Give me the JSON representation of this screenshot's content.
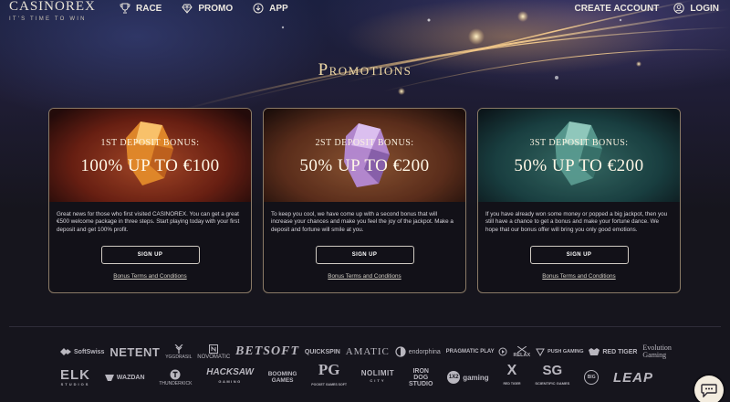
{
  "brand": {
    "name": "CASINOREX",
    "tagline": "IT'S TIME TO WIN"
  },
  "nav": {
    "left": [
      {
        "label": "RACE",
        "icon": "trophy-icon"
      },
      {
        "label": "PROMO",
        "icon": "diamond-icon"
      },
      {
        "label": "APP",
        "icon": "download-icon"
      }
    ],
    "create_account": "CREATE ACCOUNT",
    "login": "LOGIN"
  },
  "page_title": "Promotions",
  "cards": [
    {
      "subtitle": "1st Deposit Bonus:",
      "headline": "100% up to €100",
      "text": "Great news for those who first visited CASINOREX. You can get a great €500 welcome package in three steps. Start playing today with your first deposit and get 100% profit.",
      "button": "SIGN UP",
      "terms": "Bonus Terms and Conditions",
      "gem_color": "#f0a030"
    },
    {
      "subtitle": "2st Deposit Bonus:",
      "headline": "50% up to €200",
      "text": "To keep you cool, we have come up with a second bonus that will increase your chances and make you feel the joy of the jackpot. Make a deposit and fortune will smile at you.",
      "button": "SIGN UP",
      "terms": "Bonus Terms and Conditions",
      "gem_color": "#b98ad8"
    },
    {
      "subtitle": "3st Deposit Bonus:",
      "headline": "50% up to €200",
      "text": "If you have already won some money or popped a big jackpot, then you still have a chance to get a bonus and make your fortune dance. We hope that our bonus offer will bring you only good emotions.",
      "button": "SIGN UP",
      "terms": "Bonus Terms and Conditions",
      "gem_color": "#5fa89c"
    }
  ],
  "providers": {
    "row1": [
      "SoftSwiss",
      "NETENT",
      "YGGDRASIL",
      "NOVOMATIC",
      "BETSOFT",
      "QUICKSPIN",
      "AMATIC",
      "endorphina",
      "PRAGMATIC PLAY",
      "RELAX",
      "PUSH GAMING",
      "RED TIGER",
      "Evolution",
      "Gaming"
    ],
    "row2": [
      "ELK",
      "STUDIOS",
      "WAZDAN",
      "THUNDERKICK",
      "HACKSAW",
      "GAMING",
      "BOOMING",
      "GAMES",
      "PG",
      "POCKET GAMES SOFT",
      "NOLIMIT",
      "CITY",
      "IRON",
      "DOG",
      "STUDIO",
      "1X2",
      "gaming",
      "X",
      "RED TIGER",
      "SG",
      "SCIENTIFIC GAMES",
      "BIG",
      "LEAP"
    ]
  }
}
